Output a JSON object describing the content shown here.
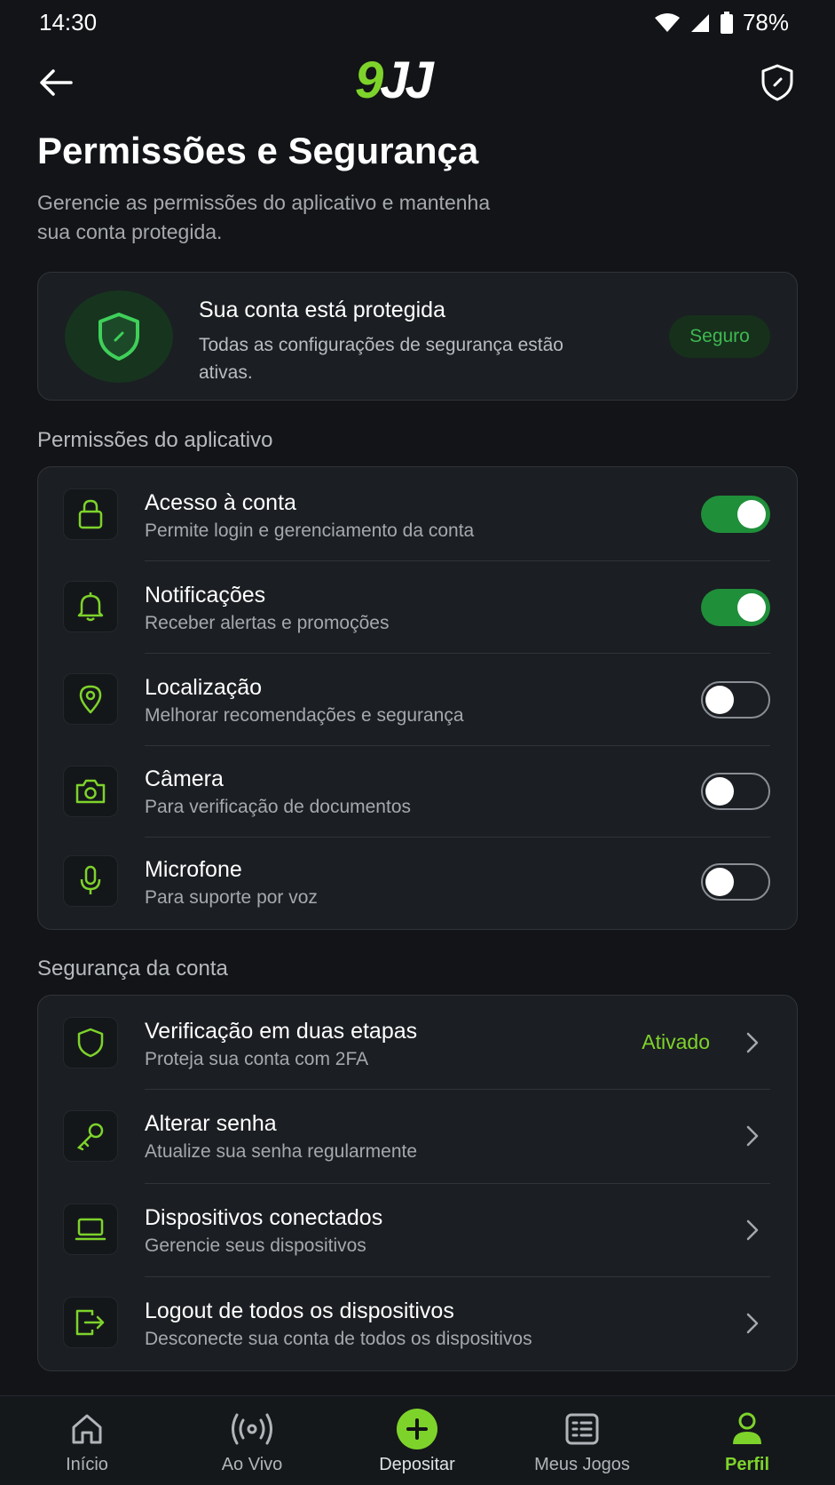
{
  "status_bar": {
    "time": "14:30",
    "battery": "78%"
  },
  "header": {
    "logo_nine": "9",
    "logo_jj": "JJ"
  },
  "page": {
    "title": "Permissões e Segurança",
    "subtitle": "Gerencie as permissões do aplicativo e mantenha sua conta protegida."
  },
  "status_card": {
    "title": "Sua conta está protegida",
    "description": "Todas as configurações de segurança estão ativas.",
    "badge": "Seguro"
  },
  "permissions": {
    "section_label": "Permissões do aplicativo",
    "items": [
      {
        "title": "Acesso à conta",
        "subtitle": "Permite login e gerenciamento da conta",
        "enabled": true,
        "icon": "lock-icon"
      },
      {
        "title": "Notificações",
        "subtitle": "Receber alertas e promoções",
        "enabled": true,
        "icon": "bell-icon"
      },
      {
        "title": "Localização",
        "subtitle": "Melhorar recomendações e segurança",
        "enabled": false,
        "icon": "location-pin-icon"
      },
      {
        "title": "Câmera",
        "subtitle": "Para verificação de documentos",
        "enabled": false,
        "icon": "camera-icon"
      },
      {
        "title": "Microfone",
        "subtitle": "Para suporte por voz",
        "enabled": false,
        "icon": "microphone-icon"
      }
    ]
  },
  "security": {
    "section_label": "Segurança da conta",
    "items": [
      {
        "title": "Verificação em duas etapas",
        "subtitle": "Proteja sua conta com 2FA",
        "status": "Ativado",
        "icon": "shield-icon"
      },
      {
        "title": "Alterar senha",
        "subtitle": "Atualize sua senha regularmente",
        "icon": "key-icon"
      },
      {
        "title": "Dispositivos conectados",
        "subtitle": "Gerencie seus dispositivos",
        "icon": "laptop-icon"
      },
      {
        "title": "Logout de todos os dispositivos",
        "subtitle": "Desconecte sua conta de todos os dispositivos",
        "icon": "logout-icon"
      }
    ]
  },
  "bottom_nav": {
    "items": [
      {
        "label": "Início",
        "icon": "home-icon"
      },
      {
        "label": "Ao Vivo",
        "icon": "live-broadcast-icon"
      },
      {
        "label": "Depositar",
        "icon": "plus-circle-icon"
      },
      {
        "label": "Meus Jogos",
        "icon": "list-icon"
      },
      {
        "label": "Perfil",
        "icon": "profile-icon",
        "active": true
      }
    ]
  },
  "colors": {
    "accent": "#7ed32b",
    "toggle_on": "#1f8f3a",
    "background": "#121417",
    "card": "#1b1e22"
  }
}
